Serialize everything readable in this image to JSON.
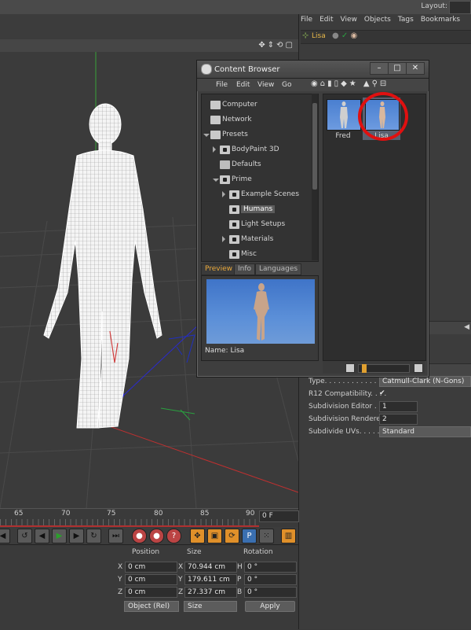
{
  "layout_label": "Layout:",
  "om_menu": [
    "File",
    "Edit",
    "View",
    "Objects",
    "Tags",
    "Bookmarks"
  ],
  "om_object": {
    "name": "Lisa"
  },
  "content_browser": {
    "title": "Content Browser",
    "menu": [
      "File",
      "Edit",
      "View",
      "Go"
    ],
    "tree": [
      {
        "label": "Computer",
        "level": 0
      },
      {
        "label": "Network",
        "level": 0
      },
      {
        "label": "Presets",
        "level": 0
      },
      {
        "label": "BodyPaint 3D",
        "level": 1
      },
      {
        "label": "Defaults",
        "level": 1
      },
      {
        "label": "Prime",
        "level": 1
      },
      {
        "label": "Example Scenes",
        "level": 2
      },
      {
        "label": "Humans",
        "level": 2,
        "selected": true
      },
      {
        "label": "Light Setups",
        "level": 2
      },
      {
        "label": "Materials",
        "level": 2
      },
      {
        "label": "Misc",
        "level": 2
      }
    ],
    "tabs": [
      "Preview",
      "Info",
      "Languages"
    ],
    "active_tab": "Preview",
    "preview_name": "Name: Lisa",
    "files": [
      {
        "label": "Fred",
        "selected": false
      },
      {
        "label": "Lisa",
        "selected": true
      }
    ]
  },
  "attributes": {
    "rows": [
      {
        "label": "Type. . . . . . . . . . . . . .",
        "value": "Catmull-Clark (N-Gons)",
        "kind": "dropdown"
      },
      {
        "label": "R12 Compatibility. . . .",
        "value": "✔",
        "kind": "checkbox"
      },
      {
        "label": "Subdivision Editor . . .",
        "value": "1",
        "kind": "number"
      },
      {
        "label": "Subdivision Renderer",
        "value": "2",
        "kind": "number"
      },
      {
        "label": "Subdivide UVs. . . . . .",
        "value": "Standard",
        "kind": "dropdown"
      }
    ]
  },
  "timeline": {
    "ticks": [
      "65",
      "70",
      "75",
      "80",
      "85",
      "90"
    ],
    "current_frame": "0 F"
  },
  "coordinates": {
    "headers": [
      "Position",
      "Size",
      "Rotation"
    ],
    "rows": [
      {
        "pos_label": "X",
        "pos": "0 cm",
        "size_label": "X",
        "size": "70.944 cm",
        "rot_label": "H",
        "rot": "0 °"
      },
      {
        "pos_label": "Y",
        "pos": "0 cm",
        "size_label": "Y",
        "size": "179.611 cm",
        "rot_label": "P",
        "rot": "0 °"
      },
      {
        "pos_label": "Z",
        "pos": "0 cm",
        "size_label": "Z",
        "size": "27.337 cm",
        "rot_label": "B",
        "rot": "0 °"
      }
    ],
    "mode": "Object (Rel)",
    "size_mode": "Size",
    "apply": "Apply"
  },
  "colors": {
    "highlight_circle": "#e01010",
    "accent": "#e8a83a",
    "selection": "#596070"
  }
}
